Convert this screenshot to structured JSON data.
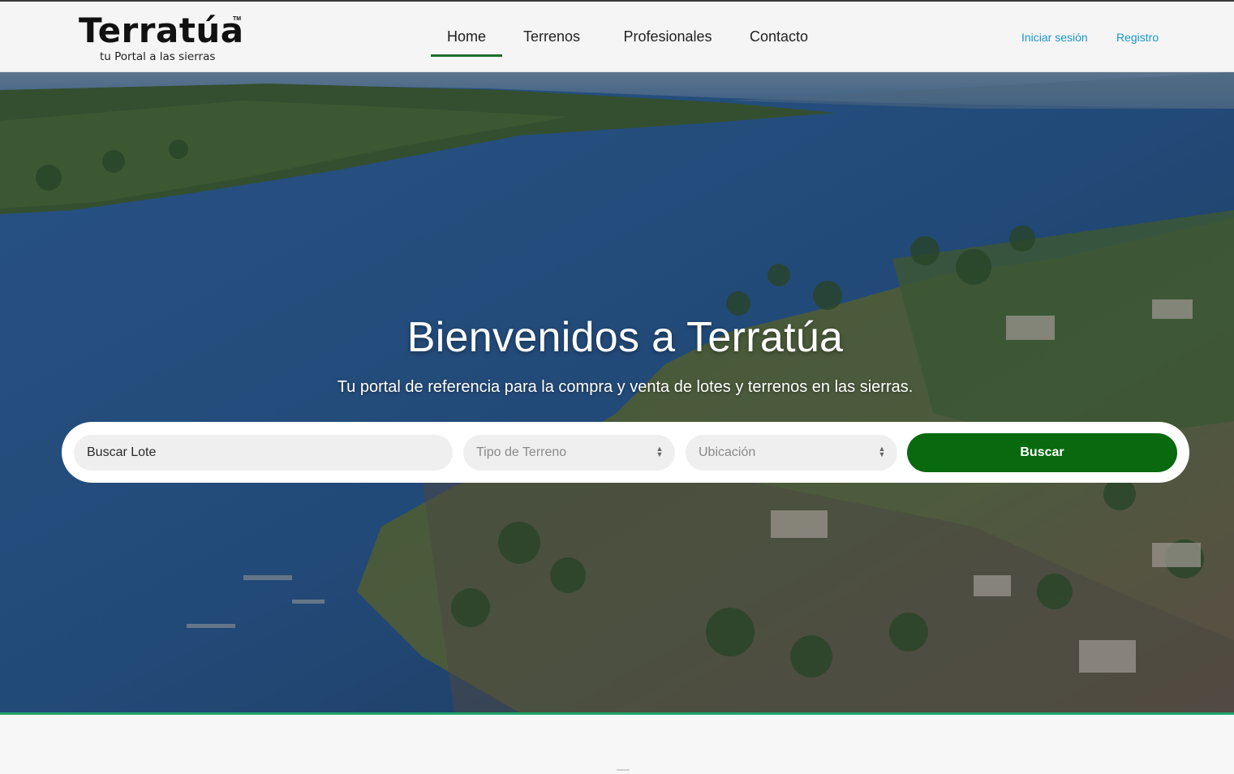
{
  "brand": {
    "name": "Terratúa",
    "trademark": "TM",
    "tagline": "tu Portal a las sierras"
  },
  "nav": {
    "items": [
      {
        "label": "Home",
        "active": true
      },
      {
        "label": "Terrenos",
        "active": false
      },
      {
        "label": "Profesionales",
        "active": false
      },
      {
        "label": "Contacto",
        "active": false
      }
    ]
  },
  "auth": {
    "login_label": "Iniciar sesión",
    "register_label": "Registro"
  },
  "hero": {
    "title": "Bienvenidos a Terratúa",
    "subtitle": "Tu portal de referencia para la compra y venta de lotes y terrenos en las sierras."
  },
  "search": {
    "lote_value": "Buscar Lote",
    "tipo_value": "Tipo de Terreno",
    "ubicacion_value": "Ubicación",
    "button_label": "Buscar"
  },
  "colors": {
    "accent": "#08690f",
    "link": "#1a96c8",
    "nav_active_underline": "#1e6b2c"
  }
}
